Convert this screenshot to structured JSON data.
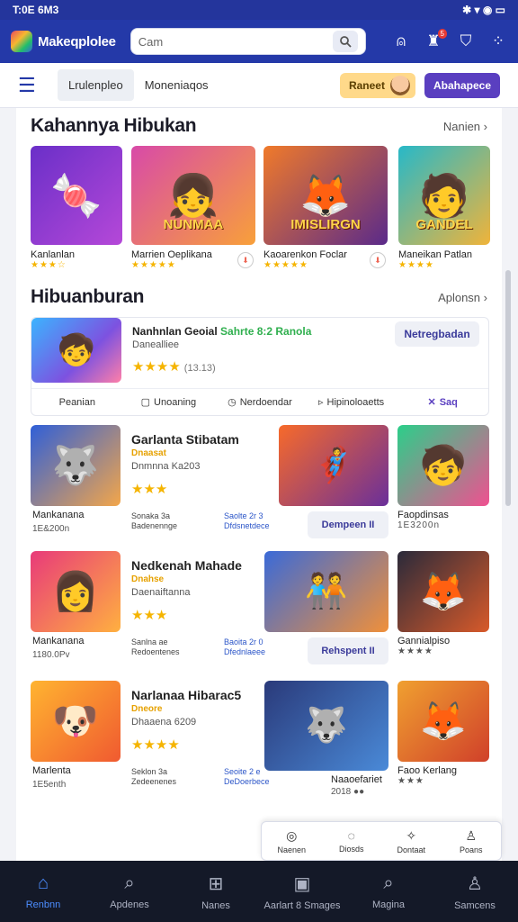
{
  "status": {
    "time": "T:0E 6M3",
    "icons": "✱ ▾ ◉ ▭"
  },
  "appbar": {
    "brand": "Makeqplolee",
    "search_value": "Cam",
    "icons": [
      "bell-icon",
      "notification-icon",
      "shop-icon",
      "more-icon"
    ],
    "badge": "5"
  },
  "subnav": {
    "tab_active": "Lrulenpleo",
    "tab2": "Moneniaqos",
    "amber_button": "Raneet",
    "purple_button": "Abahapece"
  },
  "section1": {
    "title": "Kahannya Hibukan",
    "link": "Nanien",
    "cards": [
      {
        "name": "Kanlanlan",
        "stars": "★★★☆",
        "caption": "",
        "colors": [
          "#6a2fc8",
          "#b548d8"
        ]
      },
      {
        "name": "Marrien Oeplikana",
        "stars": "★★★★★",
        "caption": "NUNMAA",
        "colors": [
          "#d84aa8",
          "#f8a03a"
        ]
      },
      {
        "name": "Kaoarenkon Foclar",
        "stars": "★★★★★",
        "caption": "IMISLIRGN",
        "colors": [
          "#f07a2a",
          "#5a2a8a"
        ]
      },
      {
        "name": "Maneikan Patlan",
        "stars": "★★★★",
        "caption": "GANDEL",
        "colors": [
          "#27b8c8",
          "#f0b43a"
        ]
      }
    ]
  },
  "section2": {
    "title": "Hibuanburan",
    "link": "Aplonsn",
    "featured": {
      "title": "Nanhnlan Geoial",
      "title_green": "Sahrte 8:2 Ranola",
      "sub": "Danealliee",
      "stars": "★★★★",
      "rating": "(13.13)",
      "button": "Netregbadan",
      "bar": [
        "Peanian",
        "Unoaning",
        "Nerdoendar",
        "Hipinoloaetts",
        "Saq"
      ]
    },
    "rows": [
      {
        "name": "Mankanana",
        "size": "1E&200n",
        "title": "Garlanta Stibatam",
        "tag": "Dnaasat",
        "meta": "Dnmnna Ka203",
        "stars": "★★★",
        "info1": "Sonaka 3a\nBadenennge",
        "info2": "Saolte 2r 3\nDfdsnetdece",
        "button": "Dempeen II",
        "card_name": "Faopdinsas",
        "card_size": "1E3200n",
        "c1": [
          "#2f5fd8",
          "#f3a64a"
        ],
        "c2": [
          "#f76a2a",
          "#6a2f9a"
        ],
        "c3": [
          "#2bcf8a",
          "#f05090"
        ]
      },
      {
        "name": "Mankanana",
        "size": "1180.0Pv",
        "title": "Nedkenah Mahade",
        "tag": "Dnahse",
        "meta": "Daenaiftanna",
        "stars": "★★★",
        "info1": "Sanlna ae\nRedoentenes",
        "info2": "Baoita 2r 0\nDfednlaeee",
        "button": "Rehspent II",
        "card_name": "Gannialpiso",
        "card_size": "★★★★",
        "c1": [
          "#e83a7a",
          "#ffb040"
        ],
        "c2": [
          "#3a6ad8",
          "#f0903a"
        ],
        "c3": [
          "#2a2a3a",
          "#d85a2a"
        ]
      },
      {
        "name": "Marlenta",
        "size": "1E5enth",
        "title": "Narlanaa Hibarac5",
        "tag": "Dneore",
        "meta": "Dhaaena 6209",
        "stars": "★★★★",
        "info1": "Seklon 3a\nZedeenenes",
        "info2": "Seoite 2 e\nDeDoerbece",
        "button": "",
        "card_name": "Faoo Kerlang",
        "card_size": "★★★",
        "sub_name": "Naaoefariet",
        "sub_size": "2018 ●●",
        "c1": [
          "#ffb430",
          "#f05a30"
        ],
        "c2": [
          "#2a3a7a",
          "#4a8ad8"
        ],
        "c3": [
          "#f0a030",
          "#d0402a"
        ]
      }
    ]
  },
  "popup": [
    "Naenen",
    "Diosds",
    "Dontaat",
    "Poans"
  ],
  "bottom_nav": [
    {
      "label": "Renbnn",
      "icon": "home-icon",
      "glyph": "⌂",
      "active": true
    },
    {
      "label": "Apdenes",
      "icon": "search-icon",
      "glyph": "⌕",
      "active": false
    },
    {
      "label": "Nanes",
      "icon": "library-icon",
      "glyph": "⊞",
      "active": false
    },
    {
      "label": "Aarlart 8 Smages",
      "icon": "square-icon",
      "glyph": "▣",
      "active": false
    },
    {
      "label": "Magina",
      "icon": "search-icon-2",
      "glyph": "⌕",
      "active": false
    },
    {
      "label": "Samcens",
      "icon": "profile-icon",
      "glyph": "♙",
      "active": false
    }
  ]
}
